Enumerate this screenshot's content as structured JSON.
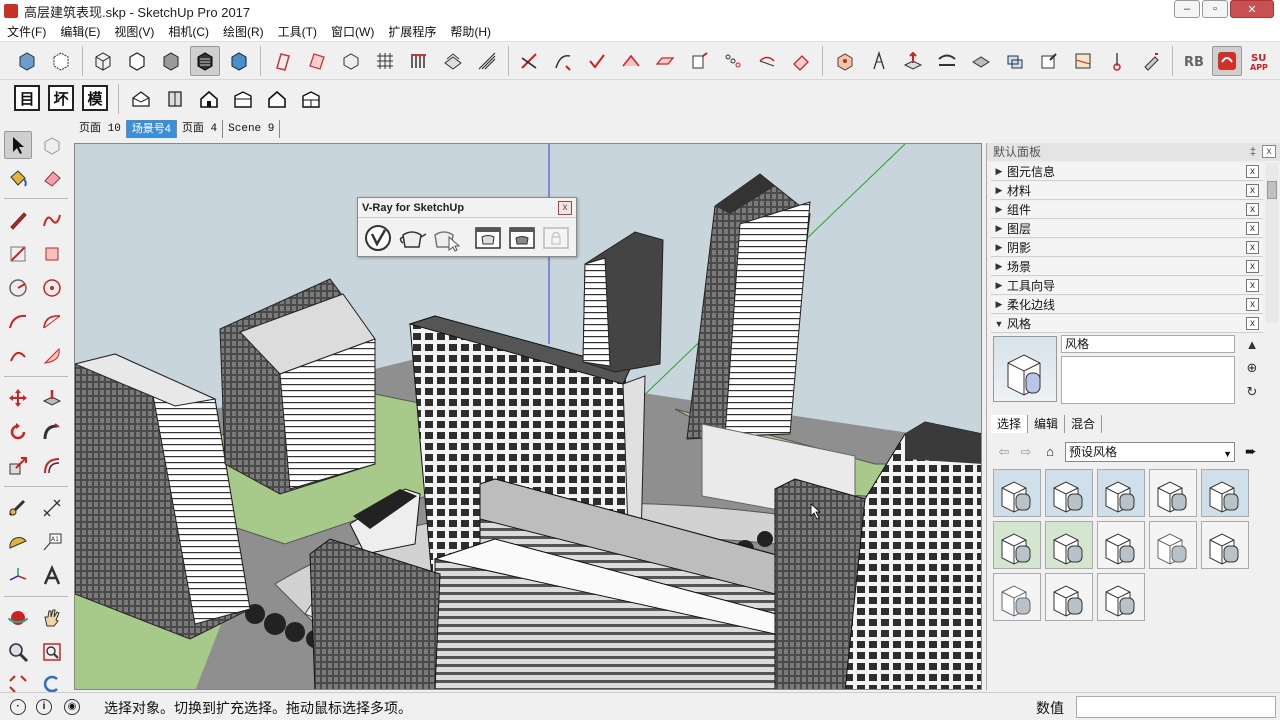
{
  "window": {
    "title": "高层建筑表现.skp - SketchUp Pro 2017",
    "controls": [
      "–",
      "▫",
      "✕"
    ]
  },
  "menu": [
    "文件(F)",
    "编辑(E)",
    "视图(V)",
    "相机(C)",
    "绘图(R)",
    "工具(T)",
    "窗口(W)",
    "扩展程序",
    "帮助(H)"
  ],
  "toolbar2": {
    "text_buttons": [
      "目",
      "坏",
      "模"
    ]
  },
  "scene_tabs": [
    "页面 10",
    "场景号4",
    "页面 4",
    "Scene 9"
  ],
  "active_scene_tab": "场景号4",
  "vray": {
    "title": "V-Ray for SketchUp",
    "close": "x"
  },
  "right_panel": {
    "header": "默认面板",
    "pin": "‡",
    "close": "x",
    "trays": [
      {
        "label": "图元信息",
        "expanded": false
      },
      {
        "label": "材料",
        "expanded": false
      },
      {
        "label": "组件",
        "expanded": false
      },
      {
        "label": "图层",
        "expanded": false
      },
      {
        "label": "阴影",
        "expanded": false
      },
      {
        "label": "场景",
        "expanded": false
      },
      {
        "label": "工具向导",
        "expanded": false
      },
      {
        "label": "柔化边线",
        "expanded": false
      },
      {
        "label": "风格",
        "expanded": true
      }
    ],
    "style_name": "风格",
    "style_tabs": [
      "选择",
      "编辑",
      "混合"
    ],
    "active_style_tab": "选择",
    "library": "预设风格"
  },
  "status": {
    "text": "选择对象。切换到扩充选择。拖动鼠标选择多项。",
    "measure_label": "数值"
  },
  "colors": {
    "accent": "#3b8fd8",
    "sky": "#c9d5dc",
    "grass": "#a7c98a"
  }
}
